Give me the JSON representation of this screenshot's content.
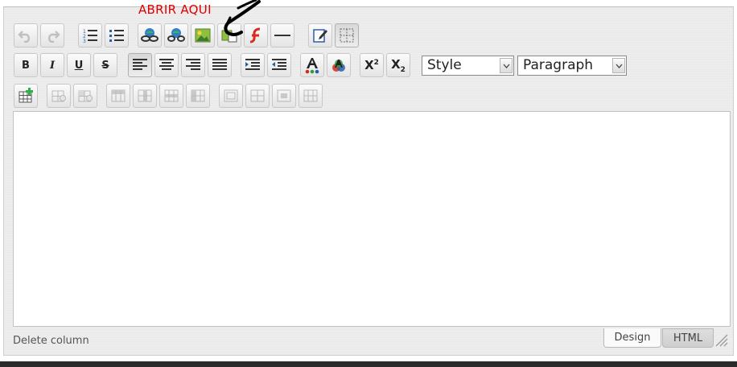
{
  "annotation": {
    "text": "ABRIR AQUI"
  },
  "toolbar": {
    "row1": [
      {
        "name": "undo-button",
        "icon": "undo-icon",
        "disabled": true
      },
      {
        "name": "redo-button",
        "icon": "redo-icon",
        "disabled": true
      },
      {
        "name": "ordered-list-button",
        "icon": "ordered-list-icon"
      },
      {
        "name": "bullet-list-button",
        "icon": "bullet-list-icon"
      },
      {
        "name": "insert-link-button",
        "icon": "link-icon"
      },
      {
        "name": "remove-link-button",
        "icon": "unlink-icon"
      },
      {
        "name": "insert-image-button",
        "icon": "image-icon"
      },
      {
        "name": "image-manager-button",
        "icon": "image-manager-icon"
      },
      {
        "name": "insert-flash-button",
        "icon": "flash-icon"
      },
      {
        "name": "horizontal-rule-button",
        "icon": "horizontal-rule-icon"
      },
      {
        "name": "edit-button",
        "icon": "edit-note-icon"
      },
      {
        "name": "toggle-borders-button",
        "icon": "table-borders-icon",
        "pressed": true
      }
    ],
    "row2": {
      "bold": "B",
      "italic": "I",
      "underline": "U",
      "strike": "S",
      "superscript": "X",
      "superscript_exp": "2",
      "subscript": "X",
      "subscript_exp": "2"
    },
    "style_select": {
      "value": "Style"
    },
    "format_select": {
      "value": "Paragraph"
    }
  },
  "colors": {
    "annotation": "#e00000",
    "content_background": "#ffffff",
    "toolbar_background": "#ececec"
  },
  "status": {
    "text": "Delete column"
  },
  "modes": {
    "design": "Design",
    "html": "HTML"
  }
}
